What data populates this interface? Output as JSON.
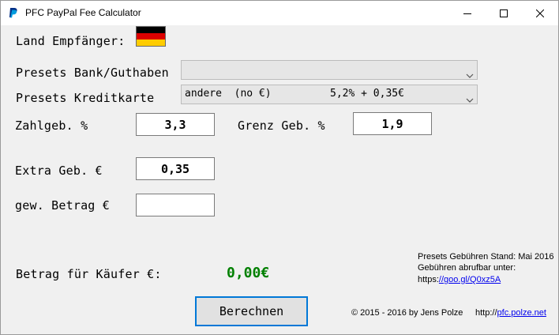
{
  "window": {
    "title": "PFC PayPal Fee Calculator",
    "controls": [
      "minimize-icon",
      "maximize-icon",
      "close-icon"
    ]
  },
  "country": {
    "label": "Land Empfänger:",
    "flag": "germany-flag",
    "flag_colors": [
      "#000000",
      "#dd0000",
      "#ffcc00"
    ]
  },
  "presets": {
    "bank_label": "Presets Bank/Guthaben",
    "bank_value": "",
    "card_label": "Presets Kreditkarte",
    "card_value": "andere  (no €)",
    "card_rate": "5,2% + 0,35€"
  },
  "fields": {
    "zahlgeb_label": "Zahlgeb. %",
    "zahlgeb_value": "3,3",
    "grenz_label": "Grenz Geb. %",
    "grenz_value": "1,9",
    "extra_label": "Extra Geb. €",
    "extra_value": "0,35",
    "betrag_label": "gew. Betrag €",
    "betrag_value": ""
  },
  "result": {
    "label": "Betrag für Käufer €:",
    "value": "0,00€",
    "color": "#008000"
  },
  "info": {
    "stand": "Presets Gebühren Stand: Mai 2016",
    "abrufbar": "Gebühren abrufbar unter:",
    "url_prefix": "https:",
    "url_link": "//goo.gl/Q0xz5A",
    "copyright": "© 2015 - 2016 by Jens Polze",
    "site_prefix": "http://",
    "site_link": "pfc.polze.net"
  },
  "actions": {
    "calculate_label": "Berechnen",
    "accent": "#0078d7"
  }
}
